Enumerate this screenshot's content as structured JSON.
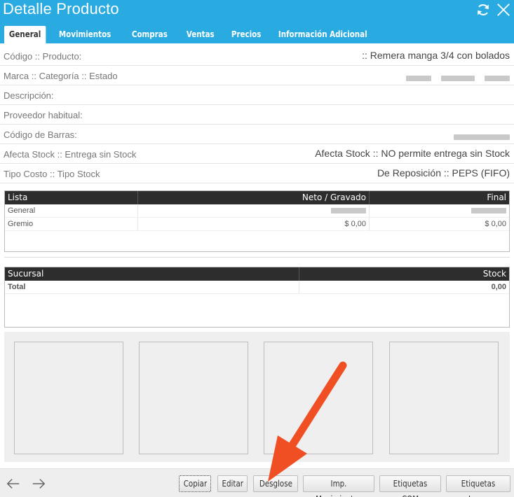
{
  "header": {
    "title": "Detalle Producto",
    "tabs": [
      {
        "label": "General"
      },
      {
        "label": "Movimientos"
      },
      {
        "label": "Compras"
      },
      {
        "label": "Ventas"
      },
      {
        "label": "Precios"
      },
      {
        "label": "Información Adicional"
      }
    ],
    "active_tab": "General",
    "accent_color": "#29abe2",
    "icons": [
      "refresh-icon",
      "close-icon"
    ]
  },
  "details": [
    {
      "label": "Código :: Producto:",
      "value": ":: Remera manga 3/4 con bolados"
    },
    {
      "label": "Marca :: Categoría :: Estado",
      "value": ""
    },
    {
      "label": "Descripción:",
      "value": ""
    },
    {
      "label": "Proveedor habitual:",
      "value": ""
    },
    {
      "label": "Código de Barras:",
      "value": ""
    },
    {
      "label": "Afecta Stock :: Entrega sin Stock",
      "value": "Afecta Stock :: NO permite entrega sin Stock"
    },
    {
      "label": "Tipo Costo :: Tipo Stock",
      "value": "De Reposición :: PEPS (FIFO)"
    }
  ],
  "price_table": {
    "columns": [
      "Lista",
      "Neto / Gravado",
      "Final"
    ],
    "rows": [
      [
        "General",
        "",
        ""
      ],
      [
        "Gremio",
        "$ 0,00",
        "$ 0,00"
      ]
    ]
  },
  "stock_table": {
    "columns": [
      "Sucursal",
      "Stock"
    ],
    "rows": [
      [
        "Total",
        "0,00"
      ]
    ]
  },
  "footer": {
    "nav": [
      "arrow-left-icon",
      "arrow-right-icon"
    ],
    "buttons": [
      {
        "label": "Copiar"
      },
      {
        "label": "Editar"
      },
      {
        "label": "Desglose"
      },
      {
        "label": "Imp. Movimientos"
      },
      {
        "label": "Etiquetas COM"
      },
      {
        "label": "Etiquetas Laser"
      }
    ]
  },
  "annotation_color": "#f04e23"
}
